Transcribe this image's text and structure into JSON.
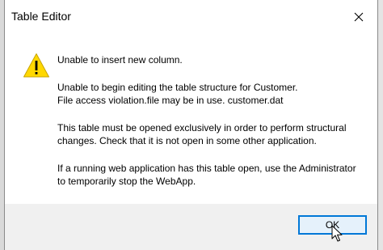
{
  "dialog": {
    "title": "Table Editor",
    "close_icon": "close-icon",
    "warning_icon": "warning-icon",
    "messages": [
      "Unable to insert new column.",
      "Unable to begin editing the table structure for Customer.",
      "File access violation.file may be in use. customer.dat",
      "This table must be opened exclusively in order to perform structural",
      "changes. Check that it is not open in some other application.",
      "If a running web application has this table open, use the Administrator",
      "to temporarily stop the WebApp."
    ],
    "ok_label": "OK"
  },
  "colors": {
    "accent": "#0078d7",
    "button_bg": "#e5f1fb",
    "footer_bg": "#f0f0f0",
    "warning_yellow": "#ffd800"
  }
}
